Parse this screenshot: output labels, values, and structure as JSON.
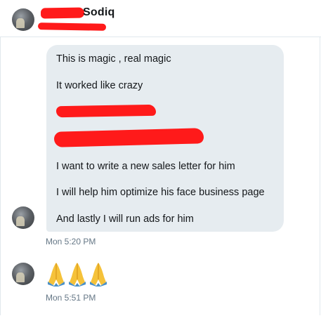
{
  "header": {
    "name_visible": "Sodiq"
  },
  "messages": [
    {
      "lines": [
        "This is magic , real magic",
        "It worked like crazy",
        "I want to write a new sales letter for him",
        "I will help him optimize his face business page",
        "And lastly I will run ads for him"
      ],
      "time": "Mon 5:20 PM"
    },
    {
      "emoji": "folded-hands x3",
      "time": "Mon 5:51 PM"
    }
  ],
  "colors": {
    "bubble": "#e6ecf0",
    "redaction": "#ff1a1a",
    "timestamp": "#657786",
    "divider": "#e1e8ed"
  }
}
